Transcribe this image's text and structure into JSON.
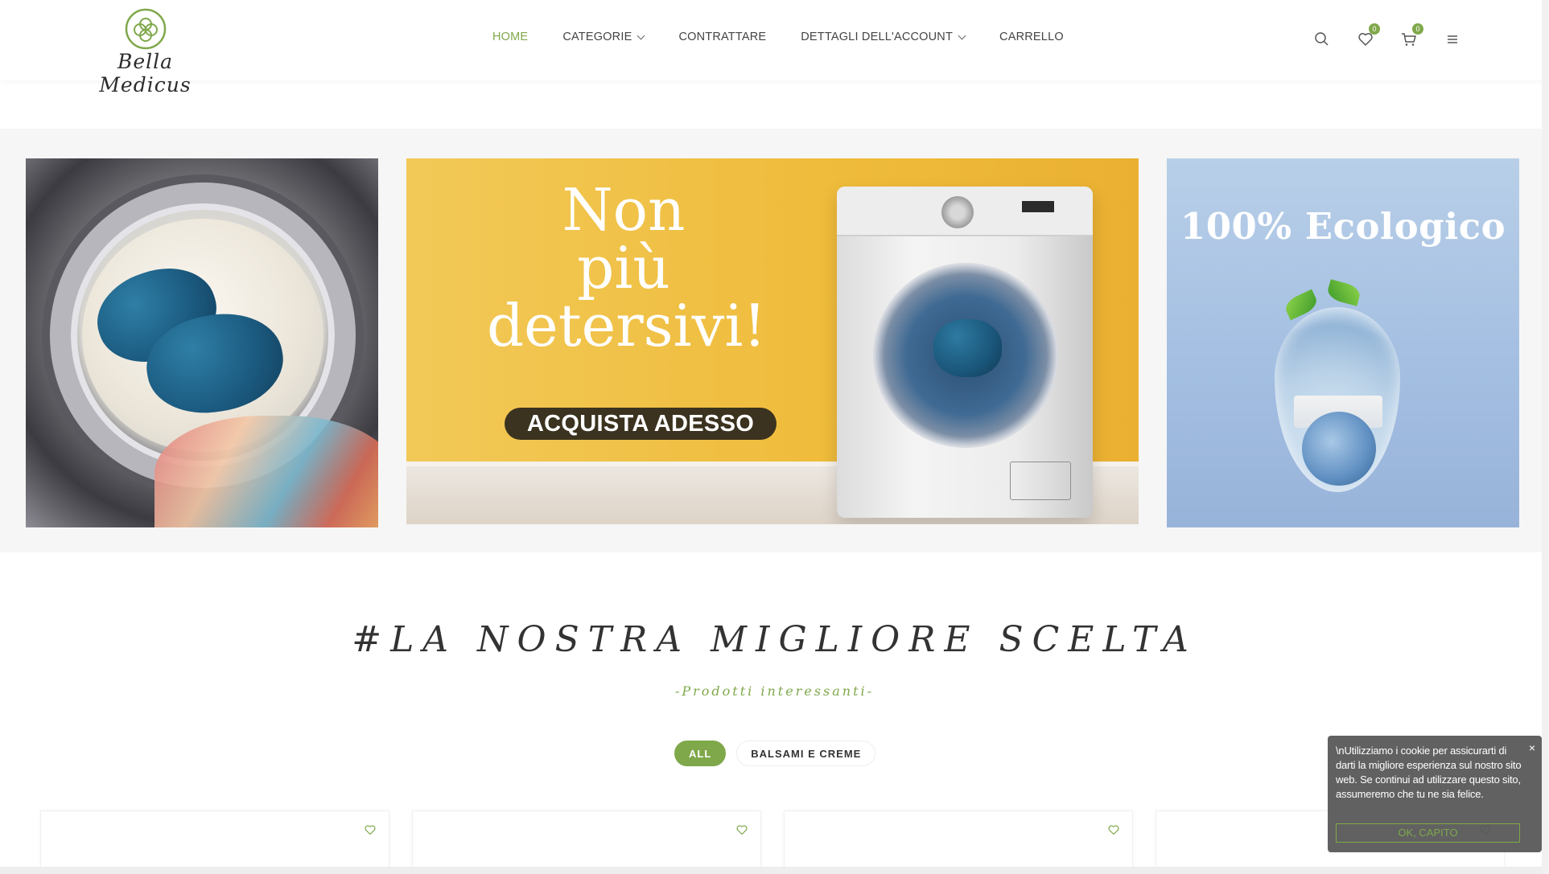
{
  "brand": {
    "name": "Bella Medicus",
    "accent": "#7fa84b"
  },
  "nav": {
    "items": [
      {
        "label": "HOME",
        "active": true,
        "dropdown": false
      },
      {
        "label": "CATEGORIE",
        "active": false,
        "dropdown": true
      },
      {
        "label": "CONTRATTARE",
        "active": false,
        "dropdown": false
      },
      {
        "label": "DETTAGLI DELL'ACCOUNT",
        "active": false,
        "dropdown": true
      },
      {
        "label": "CARRELLO",
        "active": false,
        "dropdown": false
      }
    ]
  },
  "header_icons": {
    "search": {
      "icon": "search-icon"
    },
    "wishlist": {
      "icon": "heart-icon",
      "count": "0"
    },
    "cart": {
      "icon": "cart-icon",
      "count": "0"
    },
    "menu": {
      "icon": "hamburger-icon"
    }
  },
  "banners": {
    "center": {
      "headline_lines": [
        "Non",
        "più",
        "detersivi!"
      ],
      "cta_label": "ACQUISTA ADESSO"
    },
    "right": {
      "title": "100% Ecologico"
    }
  },
  "section": {
    "title": "#LA NOSTRA MIGLIORE SCELTA",
    "subtitle": "-Prodotti interessanti-",
    "filters": [
      {
        "label": "ALL",
        "active": true
      },
      {
        "label": "BALSAMI E CREME",
        "active": false
      }
    ]
  },
  "products": [
    {
      "icon": "heart-icon"
    },
    {
      "icon": "heart-icon"
    },
    {
      "icon": "heart-icon"
    },
    {
      "icon": "heart-icon"
    }
  ],
  "cookie": {
    "text": "\\nUtilizziamo i cookie per assicurarti di darti la migliore esperienza sul nostro sito web. Se continui ad utilizzare questo sito, assumeremo che tu ne sia felice.",
    "close_label": "×",
    "button_label": "OK, CAPITO"
  }
}
